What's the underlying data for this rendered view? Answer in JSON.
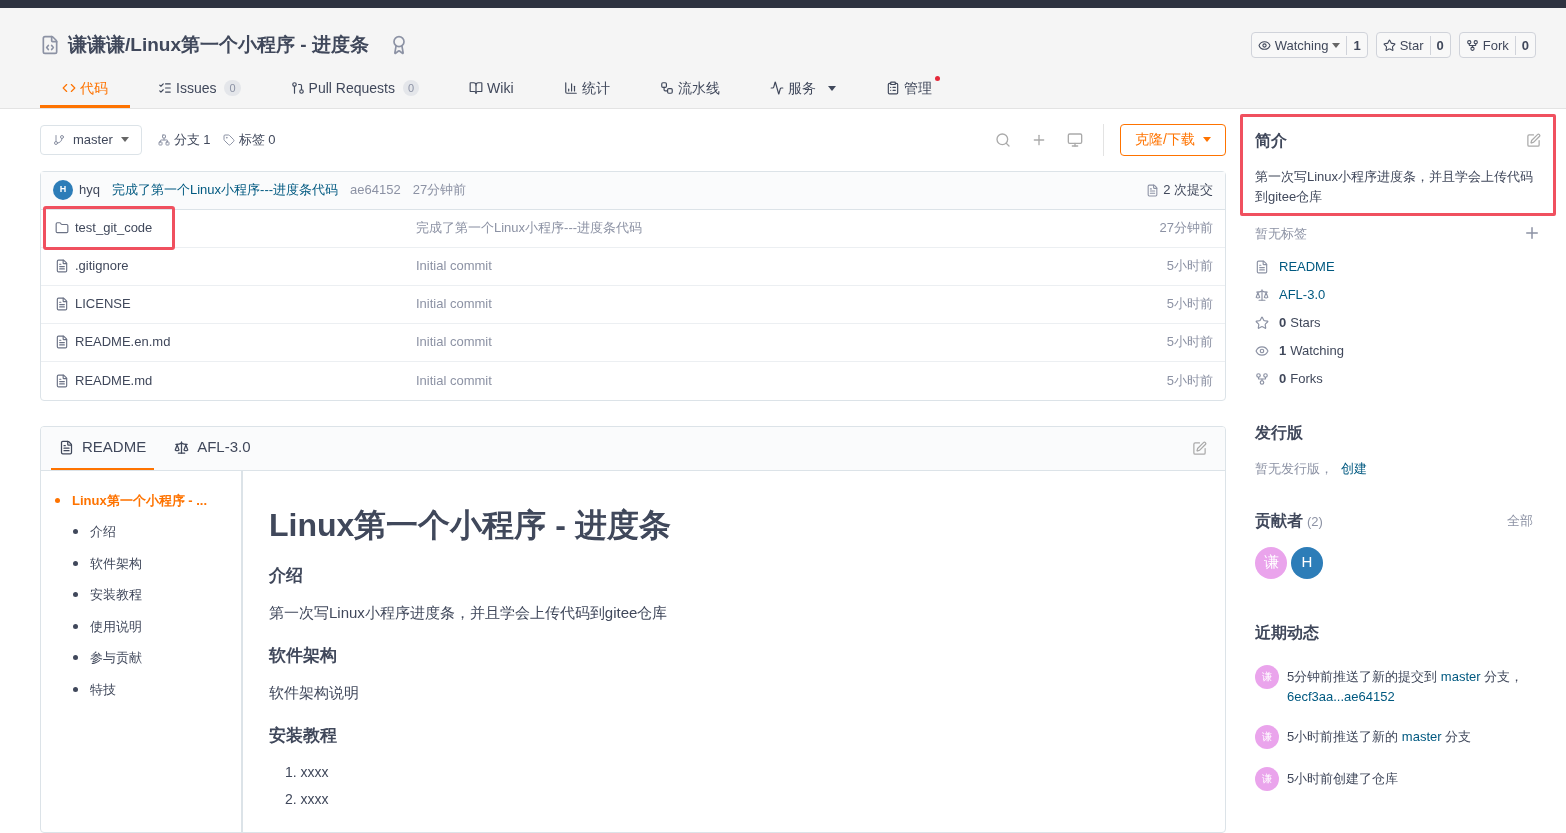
{
  "repo": {
    "title": "谦谦谦/Linux第一个小程序 - 进度条",
    "actions": [
      {
        "label": "Watching",
        "count": "1",
        "dropdown": true
      },
      {
        "label": "Star",
        "count": "0",
        "dropdown": false
      },
      {
        "label": "Fork",
        "count": "0",
        "dropdown": false
      }
    ]
  },
  "nav_tabs": [
    {
      "label": "代码",
      "selected": true
    },
    {
      "label": "Issues",
      "count": "0",
      "selected": false
    },
    {
      "label": "Pull Requests",
      "count": "0",
      "selected": false
    },
    {
      "label": "Wiki",
      "selected": false
    },
    {
      "label": "统计",
      "selected": false
    },
    {
      "label": "流水线",
      "selected": false
    },
    {
      "label": "服务",
      "dropdown": true,
      "selected": false
    },
    {
      "label": "管理",
      "notification": true,
      "selected": false
    }
  ],
  "toolbar": {
    "branch": "master",
    "branches": "分支 1",
    "tags": "标签 0",
    "clone_button": "克隆/下载"
  },
  "latest_commit": {
    "avatar": "H",
    "author": "hyq",
    "message": "完成了第一个Linux小程序---进度条代码",
    "hash": "ae64152",
    "time": "27分钟前",
    "commits": "2 次提交"
  },
  "files": [
    {
      "kind": "folder",
      "name": "test_git_code",
      "commit": "完成了第一个Linux小程序---进度条代码",
      "time": "27分钟前",
      "highlighted": true
    },
    {
      "kind": "file",
      "name": ".gitignore",
      "commit": "Initial commit",
      "time": "5小时前",
      "highlighted": false
    },
    {
      "kind": "file",
      "name": "LICENSE",
      "commit": "Initial commit",
      "time": "5小时前",
      "highlighted": false
    },
    {
      "kind": "file",
      "name": "README.en.md",
      "commit": "Initial commit",
      "time": "5小时前",
      "highlighted": false
    },
    {
      "kind": "file",
      "name": "README.md",
      "commit": "Initial commit",
      "time": "5小时前",
      "highlighted": false
    }
  ],
  "readme": {
    "tabs": [
      {
        "label": "README",
        "selected": true
      },
      {
        "label": "AFL-3.0",
        "selected": false
      }
    ],
    "toc": [
      {
        "label": "Linux第一个小程序 - ...",
        "selected": true,
        "children": [
          {
            "label": "介绍",
            "selected": false
          },
          {
            "label": "软件架构",
            "selected": false
          },
          {
            "label": "安装教程",
            "selected": false
          },
          {
            "label": "使用说明",
            "selected": false
          },
          {
            "label": "参与贡献",
            "selected": false
          },
          {
            "label": "特技",
            "selected": false
          }
        ]
      }
    ],
    "content": [
      {
        "kind": "h1",
        "text": "Linux第一个小程序 - 进度条"
      },
      {
        "kind": "h2",
        "text": "介绍"
      },
      {
        "kind": "p",
        "text": "第一次写Linux小程序进度条，并且学会上传代码到gitee仓库"
      },
      {
        "kind": "h2",
        "text": "软件架构"
      },
      {
        "kind": "p",
        "text": "软件架构说明"
      },
      {
        "kind": "h2",
        "text": "安装教程"
      },
      {
        "kind": "ol",
        "items": [
          "1. xxxx",
          "2. xxxx"
        ]
      }
    ]
  },
  "sidebar": {
    "intro": {
      "title": "简介",
      "description": "第一次写Linux小程序进度条，并且学会上传代码到gitee仓库",
      "highlighted": true
    },
    "no_tags": "暂无标签",
    "links": [
      {
        "kind": "readme",
        "label": "README"
      },
      {
        "kind": "license",
        "label": "AFL-3.0"
      },
      {
        "kind": "star",
        "count": "0",
        "label": "Stars"
      },
      {
        "kind": "watch",
        "count": "1",
        "label": "Watching"
      },
      {
        "kind": "fork",
        "count": "0",
        "label": "Forks"
      }
    ],
    "releases": {
      "title": "发行版",
      "empty": "暂无发行版，",
      "create": "创建"
    },
    "contributors": {
      "title": "贡献者",
      "count": "(2)",
      "all": "全部",
      "avatars": [
        {
          "initial": "谦",
          "color": "#eaa4ec"
        },
        {
          "initial": "H",
          "color": "#2d7db8"
        }
      ]
    },
    "activity": {
      "title": "近期动态",
      "items": [
        {
          "avatar": "谦",
          "segments": [
            {
              "kind": "text",
              "text": "5分钟前推送了新的提交到 "
            },
            {
              "kind": "link",
              "text": "master"
            },
            {
              "kind": "text",
              "text": " 分支，"
            },
            {
              "kind": "link",
              "text": "6ecf3aa...ae64152"
            }
          ]
        },
        {
          "avatar": "谦",
          "segments": [
            {
              "kind": "text",
              "text": "5小时前推送了新的 "
            },
            {
              "kind": "link",
              "text": "master"
            },
            {
              "kind": "text",
              "text": " 分支"
            }
          ]
        },
        {
          "avatar": "谦",
          "segments": [
            {
              "kind": "text",
              "text": "5小时前创建了仓库"
            }
          ]
        }
      ]
    }
  }
}
